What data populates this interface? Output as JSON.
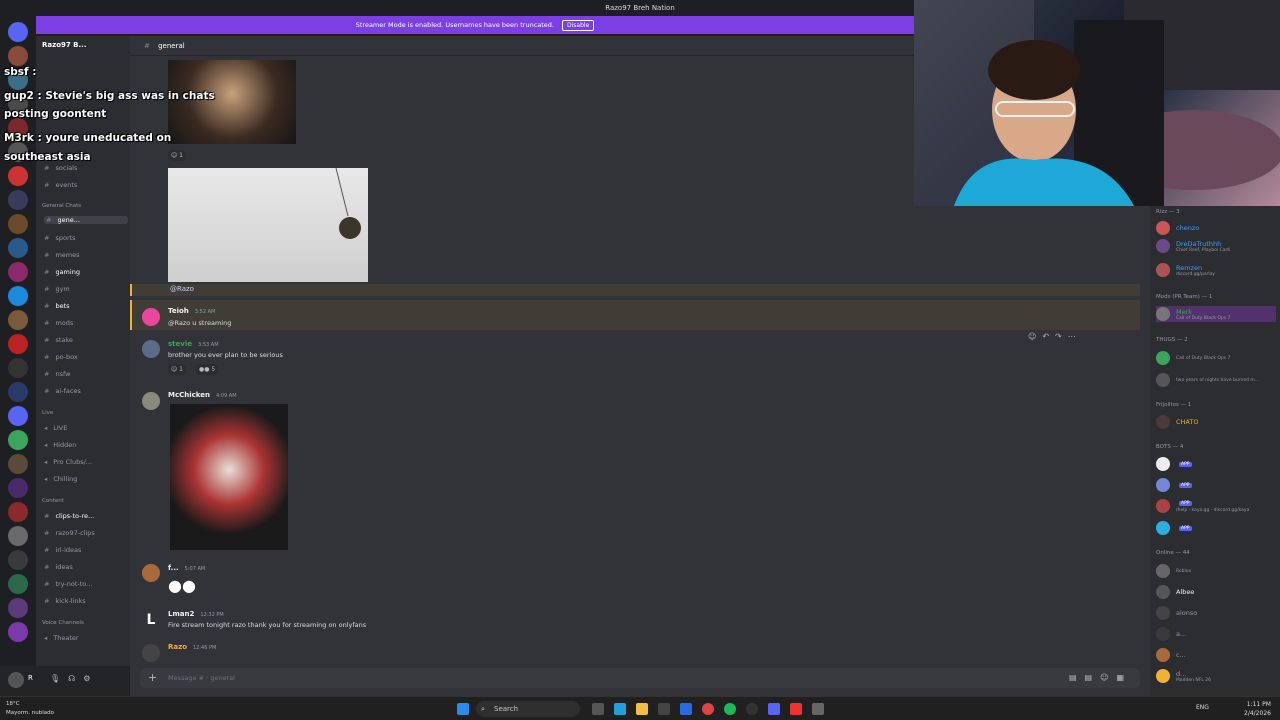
{
  "window": {
    "title": "Razo97 Breh Nation"
  },
  "banner": {
    "text": "Streamer Mode is enabled. Usernames have been truncated.",
    "action": "Disable"
  },
  "server": {
    "name": "Razo97 B..."
  },
  "channel_header": {
    "name": "general"
  },
  "channels": {
    "top": [
      {
        "label": "socials"
      },
      {
        "label": "events"
      }
    ],
    "general_chats_label": "General Chats",
    "general_chats": [
      {
        "label": "gene...",
        "active": true
      },
      {
        "label": "sports"
      },
      {
        "label": "memes"
      },
      {
        "label": "gaming"
      },
      {
        "label": "gym"
      },
      {
        "label": "bets"
      },
      {
        "label": "mods"
      },
      {
        "label": "stake"
      },
      {
        "label": "po-box"
      },
      {
        "label": "nsfw"
      },
      {
        "label": "ai-faces"
      }
    ],
    "live_label": "Live",
    "live": [
      {
        "label": "LIVE"
      },
      {
        "label": "Hidden"
      },
      {
        "label": "Pro Clubs/..."
      },
      {
        "label": "Chilling"
      }
    ],
    "content_label": "Content",
    "content": [
      {
        "label": "clips-to-re..."
      },
      {
        "label": "razo97-clips"
      },
      {
        "label": "irl-ideas"
      },
      {
        "label": "ideas"
      },
      {
        "label": "try-not-to..."
      },
      {
        "label": "kick-links"
      }
    ],
    "voice_label": "Voice Channels",
    "voice": [
      {
        "label": "Theater"
      }
    ]
  },
  "overlay_chat": [
    {
      "text": "sbsf :"
    },
    {
      "text": "gup2 : Stevie's big ass was in chats"
    },
    {
      "text": "posting goontent"
    },
    {
      "text": "M3rk : youre uneducated on"
    },
    {
      "text": "southeast asia"
    }
  ],
  "messages": [
    {
      "mention": "@Razo"
    },
    {
      "author": "Teioh",
      "time": "3:52 AM",
      "text": "@Razo u streaming"
    },
    {
      "author": "stevie",
      "time": "3:53 AM",
      "text": "brother you ever plan to be serious",
      "reactions": [
        "1",
        "5"
      ]
    },
    {
      "author": "McChicken",
      "time": "4:09 AM"
    },
    {
      "author": "f...",
      "time": "5:07 AM"
    },
    {
      "author": "Lman2",
      "time": "12:32 PM",
      "text": "Fire stream tonight razo thank you for streaming on onlyfans"
    },
    {
      "author": "Razo",
      "time": "12:46 PM"
    }
  ],
  "reaction_top": "1",
  "composer": {
    "placeholder": "Message # · general"
  },
  "members": {
    "groups": [
      {
        "label": "Rizz — 3"
      },
      {
        "label": "Mods (PR Team) — 1"
      },
      {
        "label": "THUGS — 2"
      },
      {
        "label": "Frijolitos — 1"
      },
      {
        "label": "BOTS — 4"
      },
      {
        "label": "Online — 44"
      }
    ],
    "rizz": [
      {
        "name": "chenzo",
        "color": "#3ba2ff"
      },
      {
        "name": "DreDaTruthhh",
        "color": "#3ba2ff",
        "sub": "Chief Reef, Playboi Carti"
      },
      {
        "name": "Remzen",
        "color": "#3ba2ff",
        "sub": "discord.gg/parlay"
      }
    ],
    "mods": [
      {
        "name": "Merk",
        "color": "#3ba55d",
        "sub": "Call of Duty Black Ops 7"
      }
    ],
    "thugs": [
      {
        "name": "",
        "sub": "Call of Duty Black Ops 7"
      },
      {
        "name": "",
        "sub": "two years of nights have burned m..."
      }
    ],
    "frijolitos": [
      {
        "name": "CHATO",
        "color": "#f0b232"
      }
    ],
    "bots": [
      {
        "tag": "APP"
      },
      {
        "tag": "APP"
      },
      {
        "tag": "APP",
        "sub": "/help · kaya.gg · discord.gg/kaya"
      },
      {
        "tag": "APP"
      }
    ],
    "online": [
      {
        "name": "",
        "sub": "Roblox"
      },
      {
        "name": "Albee",
        "color": "#f2f3f5"
      },
      {
        "name": "alonso",
        "color": "#949ba4"
      },
      {
        "name": "a...",
        "color": "#949ba4"
      },
      {
        "name": "c...",
        "color": "#949ba4"
      },
      {
        "name": "d...",
        "color": "#949ba4",
        "sub": "Madden NFL 26"
      }
    ]
  },
  "user_panel": {
    "name": "R",
    "status": "Mayorm. nublado",
    "temp": "18°C"
  },
  "taskbar": {
    "search": "Search",
    "lang": "ENG",
    "time": "1:11 PM",
    "date": "2/4/2026"
  },
  "colors": {
    "accent": "#5865f2",
    "banner": "#7b3fe4",
    "bg": "#313338",
    "sidebar": "#2b2d31"
  }
}
